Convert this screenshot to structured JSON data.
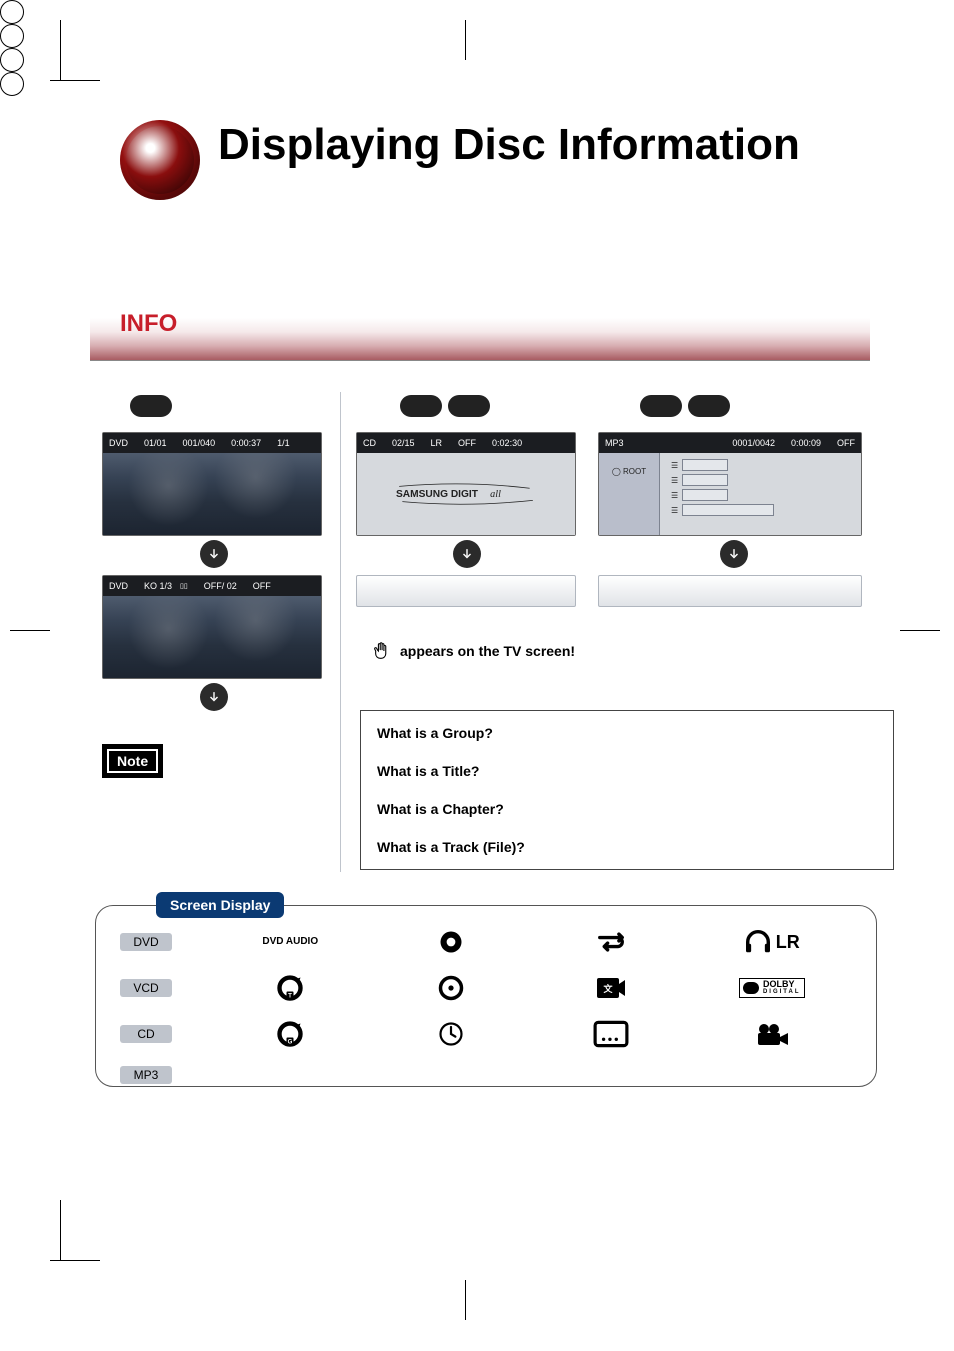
{
  "page_title": "Displaying Disc Information",
  "section_label": "INFO",
  "hand_line": "appears on the TV screen!",
  "note_tag": "Note",
  "faq": {
    "q1": "What is a Group?",
    "q2": "What is a Title?",
    "q3": "What is a Chapter?",
    "q4": "What is a Track (File)?"
  },
  "osd_dvd1": {
    "type": "DVD",
    "title": "01/01",
    "chapter": "001/040",
    "time": "0:00:37",
    "angle": "1/1"
  },
  "osd_dvd2": {
    "type": "DVD",
    "audio": "KO 1/3",
    "sub": "OFF/ 02",
    "repeat": "OFF"
  },
  "osd_cd": {
    "type": "CD",
    "track": "02/15",
    "audio": "LR",
    "repeat": "OFF",
    "time": "0:02:30"
  },
  "osd_mp3": {
    "type": "MP3",
    "file": "0001/0042",
    "time": "0:00:09",
    "repeat": "OFF",
    "folder": "ROOT"
  },
  "brand_text": "SAMSUNG DIGITall",
  "legend": {
    "title": "Screen Display",
    "discs": [
      "DVD",
      "VCD",
      "CD",
      "MP3"
    ],
    "dvd_audio": "DVD\nAUDIO",
    "lr": "LR",
    "dolby": {
      "brand": "DOLBY",
      "sub": "DIGITAL"
    }
  }
}
